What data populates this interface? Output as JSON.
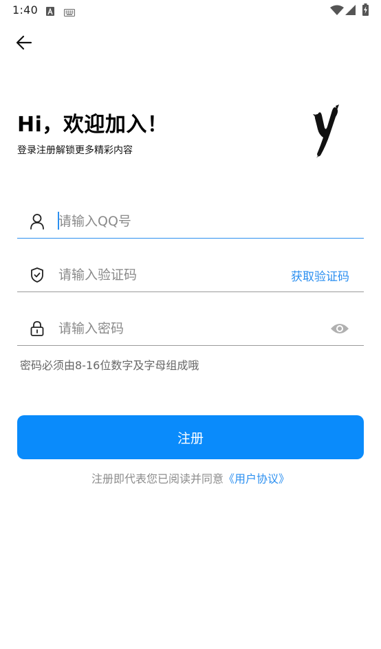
{
  "status_bar": {
    "time": "1:40",
    "icons": [
      "font-a-icon",
      "keyboard-icon",
      "wifi-icon",
      "cellular-signal-icon",
      "battery-charging-icon"
    ]
  },
  "header": {
    "back_icon": "arrow-left-icon"
  },
  "title": "Hi，欢迎加入！",
  "subtitle": "登录注册解锁更多精彩内容",
  "form": {
    "qq": {
      "icon": "user-icon",
      "placeholder": "请输入QQ号",
      "value": ""
    },
    "code": {
      "icon": "shield-check-icon",
      "placeholder": "请输入验证码",
      "value": "",
      "get_code_label": "获取验证码"
    },
    "password": {
      "icon": "lock-icon",
      "placeholder": "请输入密码",
      "value": "",
      "visibility_icon": "eye-icon"
    },
    "hint": "密码必须由8-16位数字及字母组成哦"
  },
  "register_label": "注册",
  "agreement": {
    "text": "注册即代表您已阅读并同意",
    "link": "《用户协议》"
  },
  "colors": {
    "accent": "#0a8bfb",
    "link": "#2b8ff0",
    "divider": "#9a9a9a",
    "placeholder": "#8a8a8a"
  }
}
